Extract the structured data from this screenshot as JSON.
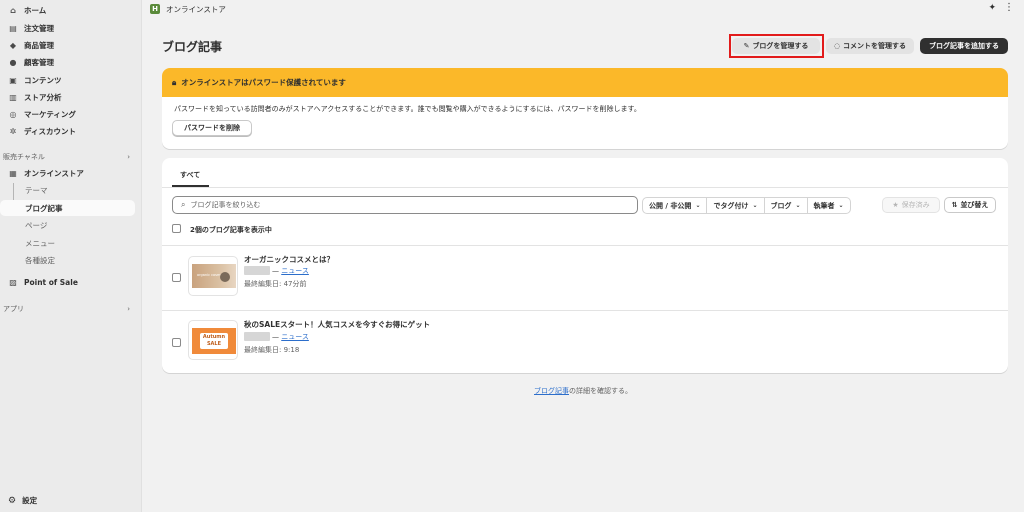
{
  "sidebar": {
    "items": [
      {
        "label": "ホーム",
        "icon": "home-icon",
        "glyph": "⌂"
      },
      {
        "label": "注文管理",
        "icon": "orders-icon",
        "glyph": "▤"
      },
      {
        "label": "商品管理",
        "icon": "tag-icon",
        "glyph": "◆"
      },
      {
        "label": "顧客管理",
        "icon": "person-icon",
        "glyph": "●"
      },
      {
        "label": "コンテンツ",
        "icon": "content-icon",
        "glyph": "▣"
      },
      {
        "label": "ストア分析",
        "icon": "analytics-icon",
        "glyph": "▥"
      },
      {
        "label": "マーケティング",
        "icon": "target-icon",
        "glyph": "◎"
      },
      {
        "label": "ディスカウント",
        "icon": "discount-icon",
        "glyph": "✲"
      }
    ],
    "sales_channels_label": "販売チャネル",
    "online_store_label": "オンラインストア",
    "sub_items": [
      "テーマ",
      "ブログ記事",
      "ページ",
      "メニュー",
      "各種設定"
    ],
    "pos_label": "Point of Sale",
    "apps_label": "アプリ",
    "settings_label": "設定"
  },
  "topbar": {
    "title": "オンラインストア",
    "logo_letter": "H"
  },
  "page": {
    "title": "ブログ記事",
    "manage_blogs": "ブログを管理する",
    "manage_comments": "コメントを管理する",
    "add_post": "ブログ記事を追加する"
  },
  "banner": {
    "heading": "オンラインストアはパスワード保護されています",
    "text": "パスワードを知っている訪問者のみがストアへアクセスすることができます。誰でも閲覧や購入ができるようにするには、パスワードを削除します。",
    "button": "パスワードを削除"
  },
  "list": {
    "tab_all": "すべて",
    "search_placeholder": "ブログ記事を絞り込む",
    "filters": [
      "公開 / 非公開",
      "でタグ付け",
      "ブログ",
      "執筆者"
    ],
    "saved": "保存済み",
    "sort": "並び替え",
    "count_text": "2個のブログ記事を表示中",
    "author_sep": "— ",
    "posts": [
      {
        "title": "オーガニックコスメとは？",
        "blog": "ニュース",
        "edited": "最終編集日: 47分前",
        "thumb_text": "organic cosmetics"
      },
      {
        "title": "秋のSALEスタート！人気コスメを今すぐお得にゲット",
        "blog": "ニュース",
        "edited": "最終編集日: 9:18",
        "thumb_text": "Autumn SALE"
      }
    ]
  },
  "footer": {
    "link": "ブログ記事",
    "suffix": "の詳細を確認する。"
  },
  "colors": {
    "banner": "#fbb829",
    "highlight": "#e21b1b",
    "link": "#2c6ecb",
    "primary_button": "#303030"
  }
}
